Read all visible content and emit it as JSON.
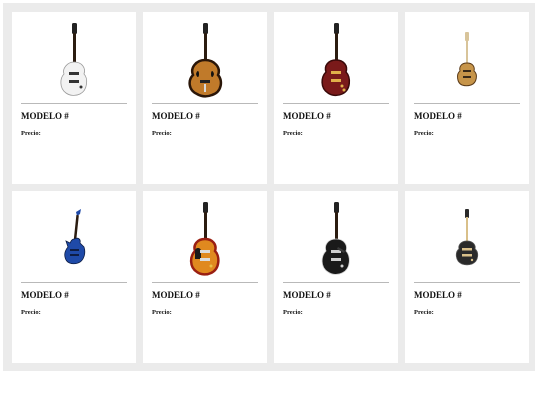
{
  "products": [
    {
      "icon": "guitar-icon",
      "model_label": "MODELO #",
      "price_label": "Precio:",
      "color": "#f2f2f2",
      "accent": "#333333"
    },
    {
      "icon": "guitar-icon",
      "model_label": "MODELO #",
      "price_label": "Precio:",
      "color": "#c07a2a",
      "accent": "#2a1608"
    },
    {
      "icon": "guitar-icon",
      "model_label": "MODELO #",
      "price_label": "Precio:",
      "color": "#7a1a1a",
      "accent": "#e0b04a"
    },
    {
      "icon": "guitar-icon",
      "model_label": "MODELO #",
      "price_label": "Precio:",
      "color": "#c7954a",
      "accent": "#5a3a18"
    },
    {
      "icon": "guitar-icon",
      "model_label": "MODELO #",
      "price_label": "Precio:",
      "color": "#1f4aa8",
      "accent": "#0e1d44"
    },
    {
      "icon": "guitar-icon",
      "model_label": "MODELO #",
      "price_label": "Precio:",
      "color": "#e0891f",
      "accent": "#9a1f12"
    },
    {
      "icon": "guitar-icon",
      "model_label": "MODELO #",
      "price_label": "Precio:",
      "color": "#1a1a1a",
      "accent": "#cfcfcf"
    },
    {
      "icon": "guitar-icon",
      "model_label": "MODELO #",
      "price_label": "Precio:",
      "color": "#2a2a2a",
      "accent": "#d9c08a"
    }
  ]
}
